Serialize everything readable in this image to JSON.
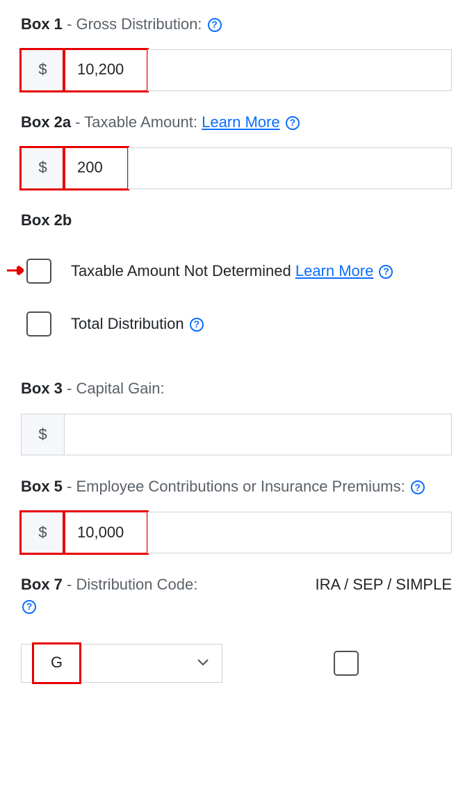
{
  "currency": "$",
  "box1": {
    "bold": "Box 1",
    "rest": " - Gross Distribution: ",
    "value": "10,200"
  },
  "box2a": {
    "bold": "Box 2a",
    "rest": " - Taxable Amount: ",
    "link": "Learn More",
    "value": "200"
  },
  "box2b": {
    "bold": "Box 2b"
  },
  "check_tand": {
    "label": "Taxable Amount Not Determined ",
    "link": "Learn More"
  },
  "check_total": {
    "label": "Total Distribution "
  },
  "box3": {
    "bold": "Box 3",
    "rest": " - Capital Gain:",
    "value": ""
  },
  "box5": {
    "bold": "Box 5",
    "rest": " - Employee Contributions or Insurance Premiums: ",
    "value": "10,000"
  },
  "box7": {
    "bold": "Box 7",
    "rest": " - Distribution Code: ",
    "right_label": "IRA / SEP / SIMPLE",
    "value": "G"
  },
  "help_glyph": "?"
}
